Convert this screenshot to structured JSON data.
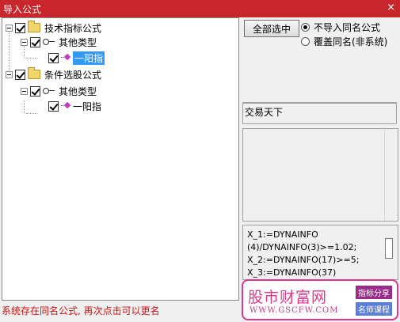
{
  "window": {
    "title": "导入公式",
    "close_glyph": "×"
  },
  "tree": {
    "groups": [
      {
        "label": "技术指标公式",
        "child": {
          "label": "其他类型",
          "leaf": "一阳指"
        }
      },
      {
        "label": "条件选股公式",
        "child": {
          "label": "其他类型",
          "leaf": "一阳指"
        }
      }
    ]
  },
  "options": {
    "select_all_label": "全部选中",
    "radio_skip_label": "不导入同名公式",
    "radio_overwrite_label": "覆盖同名(非系统)"
  },
  "author": "交易天下",
  "code_lines": [
    "X_1:=DYNAINFO",
    "(4)/DYNAINFO(3)>=1.02;",
    "X_2:=DYNAINFO(17)>=5;",
    "X_3:=DYNAINFO(37)"
  ],
  "watermark": {
    "brand": "股市财富网",
    "url": "WWW.GSCFW.COM",
    "tag1": "指标分享",
    "tag2": "名师课程"
  },
  "status_text": "系统存在同名公式, 再次点击可以更名",
  "colors": {
    "title_bar": "#c8262c",
    "selection": "#3399ff",
    "status": "#d01010",
    "logo": "#e0378a"
  }
}
